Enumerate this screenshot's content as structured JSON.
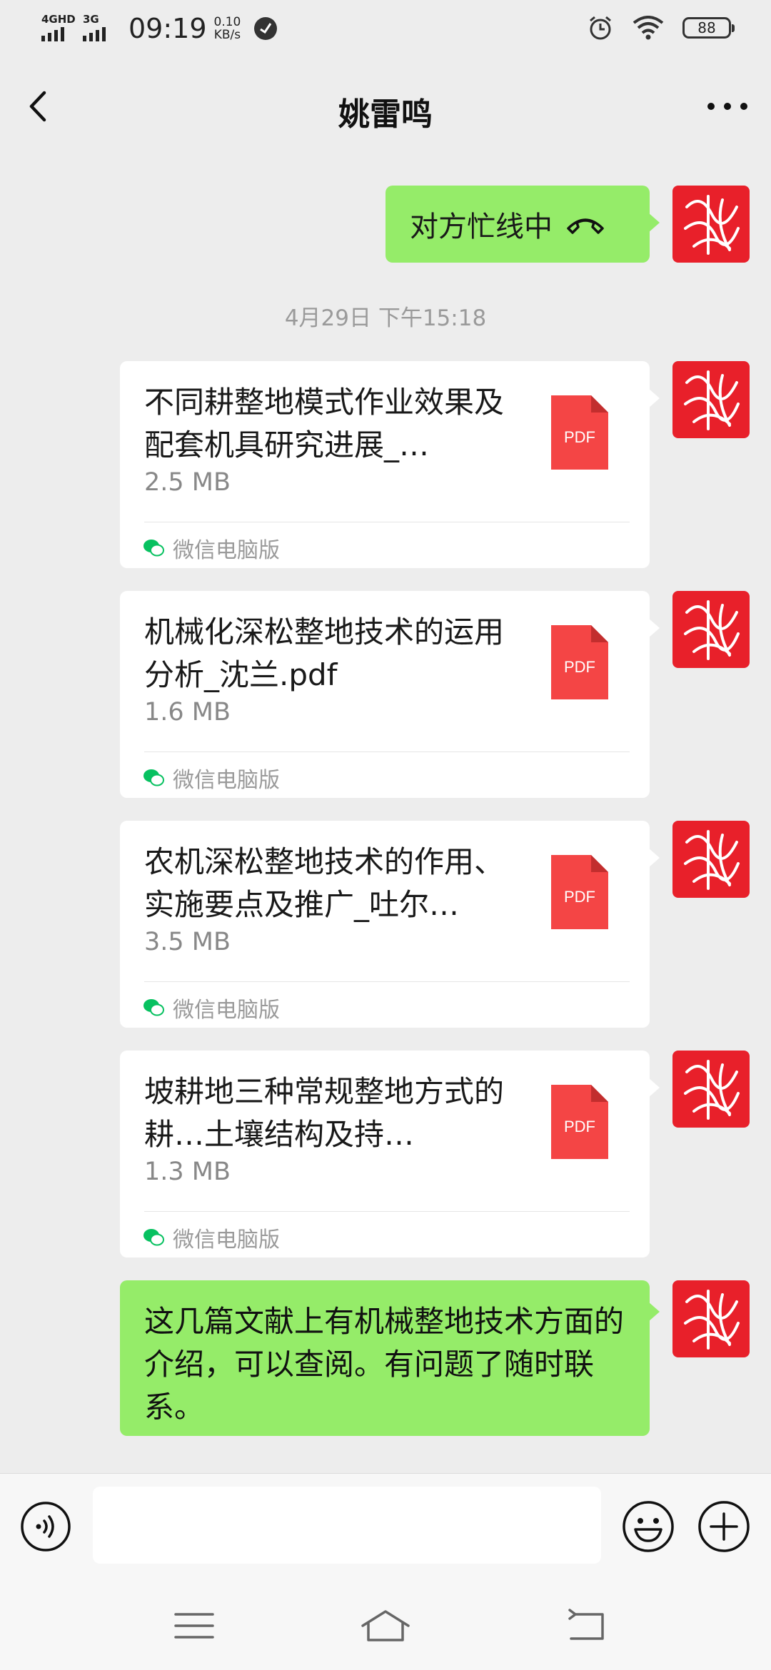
{
  "status_bar": {
    "network1": "4GHD",
    "network2": "3G",
    "time": "09:19",
    "speed_value": "0.10",
    "speed_unit": "KB/s",
    "battery": "88"
  },
  "header": {
    "title": "姚雷鸣"
  },
  "messages": {
    "call": {
      "text": "对方忙线中"
    },
    "timestamp": "4月29日 下午15:18",
    "files": [
      {
        "name": "不同耕整地模式作业效果及配套机具研究进展_…",
        "size": "2.5 MB",
        "source": "微信电脑版",
        "icon_label": "PDF"
      },
      {
        "name": "机械化深松整地技术的运用分析_沈兰.pdf",
        "size": "1.6 MB",
        "source": "微信电脑版",
        "icon_label": "PDF"
      },
      {
        "name": "农机深松整地技术的作用、实施要点及推广_吐尔…",
        "size": "3.5 MB",
        "source": "微信电脑版",
        "icon_label": "PDF"
      },
      {
        "name": "坡耕地三种常规整地方式的耕…土壤结构及持…",
        "size": "1.3 MB",
        "source": "微信电脑版",
        "icon_label": "PDF"
      }
    ],
    "text_message": "这几篇文献上有机械整地技术方面的介绍，可以查阅。有问题了随时联系。"
  },
  "input_bar": {
    "value": "",
    "icons": [
      "voice-icon",
      "emoji-icon",
      "plus-icon"
    ]
  },
  "colors": {
    "bubble_green": "#95ec69",
    "pdf_red": "#f44545",
    "avatar_red": "#e8202a",
    "background": "#ededed"
  }
}
